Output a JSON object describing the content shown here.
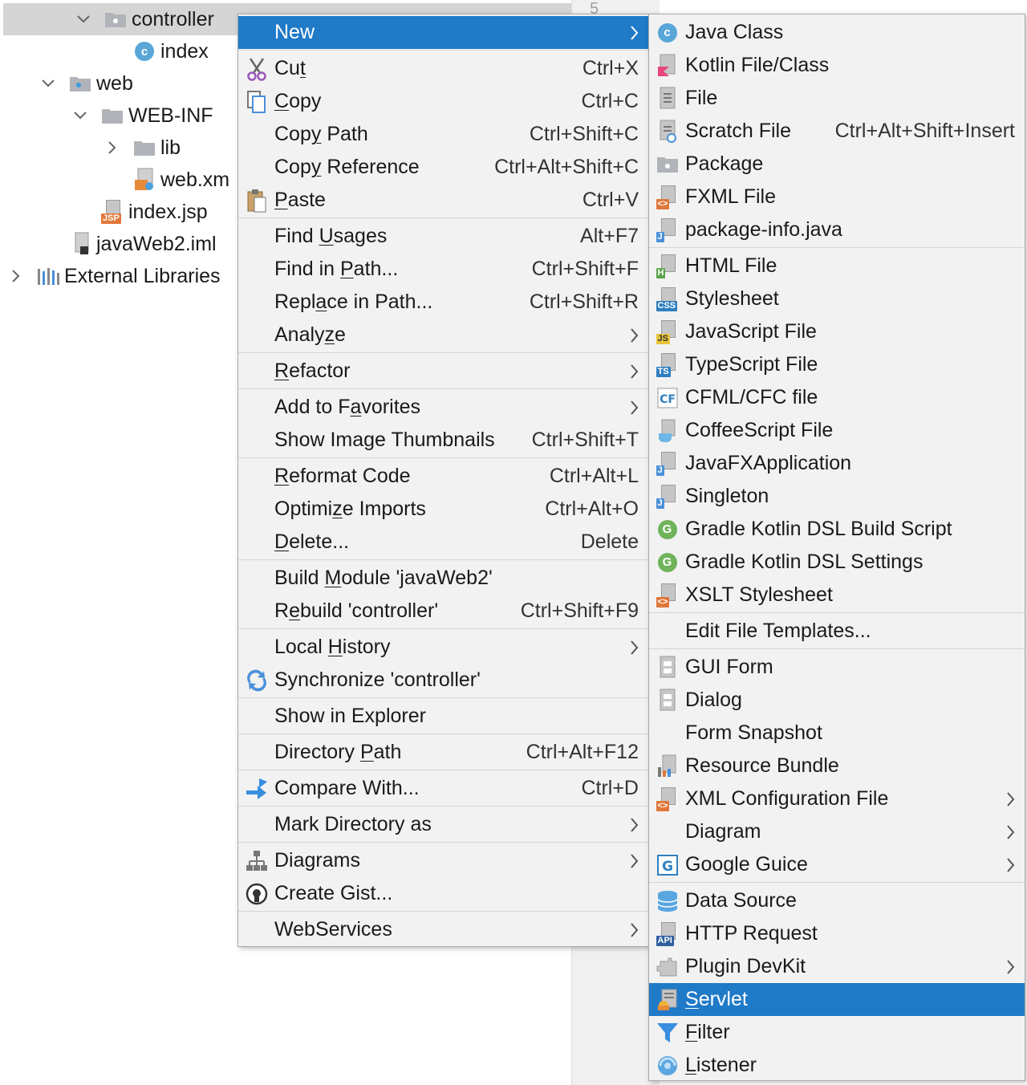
{
  "tree": {
    "items": [
      {
        "label": "controller",
        "icon": "package-folder-icon",
        "expanded": true
      },
      {
        "label": "index",
        "icon": "java-class-icon"
      },
      {
        "label": "web",
        "icon": "web-folder-icon",
        "expanded": true
      },
      {
        "label": "WEB-INF",
        "icon": "folder-icon",
        "expanded": true
      },
      {
        "label": "lib",
        "icon": "folder-icon",
        "expanded": false
      },
      {
        "label": "web.xm",
        "icon": "xml-file-icon"
      },
      {
        "label": "index.jsp",
        "icon": "jsp-file-icon"
      },
      {
        "label": "javaWeb2.iml",
        "icon": "iml-file-icon"
      },
      {
        "label": "External Libraries",
        "icon": "libraries-icon",
        "expanded": false
      }
    ],
    "line_number": "5"
  },
  "context_menu": {
    "groups": [
      [
        {
          "pre": "",
          "u": "",
          "post": "New",
          "shortcut": "",
          "submenu": true,
          "highlighted": true,
          "icon": ""
        }
      ],
      [
        {
          "pre": "Cu",
          "u": "t",
          "post": "",
          "shortcut": "Ctrl+X",
          "icon": "scissors-icon"
        },
        {
          "pre": "",
          "u": "C",
          "post": "opy",
          "shortcut": "Ctrl+C",
          "icon": "copy-icon"
        },
        {
          "pre": "Cop",
          "u": "y",
          "post": " Path",
          "shortcut": "Ctrl+Shift+C",
          "icon": ""
        },
        {
          "pre": "Cop",
          "u": "y",
          "post": " Reference",
          "shortcut": "Ctrl+Alt+Shift+C",
          "icon": ""
        },
        {
          "pre": "",
          "u": "P",
          "post": "aste",
          "shortcut": "Ctrl+V",
          "icon": "paste-icon"
        }
      ],
      [
        {
          "pre": "Find ",
          "u": "U",
          "post": "sages",
          "shortcut": "Alt+F7",
          "icon": ""
        },
        {
          "pre": "Find in ",
          "u": "P",
          "post": "ath...",
          "shortcut": "Ctrl+Shift+F",
          "icon": ""
        },
        {
          "pre": "Repl",
          "u": "a",
          "post": "ce in Path...",
          "shortcut": "Ctrl+Shift+R",
          "icon": ""
        },
        {
          "pre": "Analy",
          "u": "z",
          "post": "e",
          "shortcut": "",
          "submenu": true,
          "icon": ""
        }
      ],
      [
        {
          "pre": "",
          "u": "R",
          "post": "efactor",
          "shortcut": "",
          "submenu": true,
          "icon": ""
        }
      ],
      [
        {
          "pre": "Add to F",
          "u": "a",
          "post": "vorites",
          "shortcut": "",
          "submenu": true,
          "icon": ""
        },
        {
          "pre": "Show Image Thumbnails",
          "u": "",
          "post": "",
          "shortcut": "Ctrl+Shift+T",
          "icon": ""
        }
      ],
      [
        {
          "pre": "",
          "u": "R",
          "post": "eformat Code",
          "shortcut": "Ctrl+Alt+L",
          "icon": ""
        },
        {
          "pre": "Optimi",
          "u": "z",
          "post": "e Imports",
          "shortcut": "Ctrl+Alt+O",
          "icon": ""
        },
        {
          "pre": "",
          "u": "D",
          "post": "elete...",
          "shortcut": "Delete",
          "icon": ""
        }
      ],
      [
        {
          "pre": "Build ",
          "u": "M",
          "post": "odule 'javaWeb2'",
          "shortcut": "",
          "icon": ""
        },
        {
          "pre": "R",
          "u": "e",
          "post": "build 'controller'",
          "shortcut": "Ctrl+Shift+F9",
          "icon": ""
        }
      ],
      [
        {
          "pre": "Local ",
          "u": "H",
          "post": "istory",
          "shortcut": "",
          "submenu": true,
          "icon": ""
        },
        {
          "pre": "Synchronize 'controller'",
          "u": "",
          "post": "",
          "shortcut": "",
          "icon": "sync-icon"
        }
      ],
      [
        {
          "pre": "Show in Explorer",
          "u": "",
          "post": "",
          "shortcut": "",
          "icon": ""
        }
      ],
      [
        {
          "pre": "Directory ",
          "u": "P",
          "post": "ath",
          "shortcut": "Ctrl+Alt+F12",
          "icon": ""
        }
      ],
      [
        {
          "pre": "Compare With...",
          "u": "",
          "post": "",
          "shortcut": "Ctrl+D",
          "icon": "compare-icon"
        }
      ],
      [
        {
          "pre": "Mark Directory as",
          "u": "",
          "post": "",
          "shortcut": "",
          "submenu": true,
          "icon": ""
        }
      ],
      [
        {
          "pre": "Diagrams",
          "u": "",
          "post": "",
          "shortcut": "",
          "submenu": true,
          "icon": "diagrams-icon"
        },
        {
          "pre": "Create Gist...",
          "u": "",
          "post": "",
          "shortcut": "",
          "icon": "github-icon"
        }
      ],
      [
        {
          "pre": "WebServices",
          "u": "",
          "post": "",
          "shortcut": "",
          "submenu": true,
          "icon": ""
        }
      ]
    ]
  },
  "new_submenu": {
    "groups": [
      [
        {
          "pre": "Java Class",
          "u": "",
          "post": "",
          "shortcut": "",
          "icon": "java-class-icon"
        },
        {
          "pre": "Kotlin File/Class",
          "u": "",
          "post": "",
          "shortcut": "",
          "icon": "kotlin-file-icon"
        },
        {
          "pre": "File",
          "u": "",
          "post": "",
          "shortcut": "",
          "icon": "file-icon"
        },
        {
          "pre": "Scratch File",
          "u": "",
          "post": "",
          "shortcut": "Ctrl+Alt+Shift+Insert",
          "icon": "scratch-file-icon"
        },
        {
          "pre": "Package",
          "u": "",
          "post": "",
          "shortcut": "",
          "icon": "package-icon"
        },
        {
          "pre": "FXML File",
          "u": "",
          "post": "",
          "shortcut": "",
          "icon": "fxml-file-icon"
        },
        {
          "pre": "package-info.java",
          "u": "",
          "post": "",
          "shortcut": "",
          "icon": "package-info-icon"
        }
      ],
      [
        {
          "pre": "HTML File",
          "u": "",
          "post": "",
          "shortcut": "",
          "icon": "html-file-icon"
        },
        {
          "pre": "Stylesheet",
          "u": "",
          "post": "",
          "shortcut": "",
          "icon": "css-file-icon"
        },
        {
          "pre": "JavaScript File",
          "u": "",
          "post": "",
          "shortcut": "",
          "icon": "js-file-icon"
        },
        {
          "pre": "TypeScript File",
          "u": "",
          "post": "",
          "shortcut": "",
          "icon": "ts-file-icon"
        },
        {
          "pre": "CFML/CFC file",
          "u": "",
          "post": "",
          "shortcut": "",
          "icon": "cfml-file-icon"
        },
        {
          "pre": "CoffeeScript File",
          "u": "",
          "post": "",
          "shortcut": "",
          "icon": "coffeescript-file-icon"
        },
        {
          "pre": "JavaFXApplication",
          "u": "",
          "post": "",
          "shortcut": "",
          "icon": "javafx-file-icon"
        },
        {
          "pre": "Singleton",
          "u": "",
          "post": "",
          "shortcut": "",
          "icon": "singleton-file-icon"
        },
        {
          "pre": "Gradle Kotlin DSL Build Script",
          "u": "",
          "post": "",
          "shortcut": "",
          "icon": "gradle-icon"
        },
        {
          "pre": "Gradle Kotlin DSL Settings",
          "u": "",
          "post": "",
          "shortcut": "",
          "icon": "gradle-icon"
        },
        {
          "pre": "XSLT Stylesheet",
          "u": "",
          "post": "",
          "shortcut": "",
          "icon": "xslt-file-icon"
        }
      ],
      [
        {
          "pre": "Edit File Templates...",
          "u": "",
          "post": "",
          "shortcut": "",
          "icon": ""
        }
      ],
      [
        {
          "pre": "GUI Form",
          "u": "",
          "post": "",
          "shortcut": "",
          "icon": "gui-form-icon"
        },
        {
          "pre": "Dialog",
          "u": "",
          "post": "",
          "shortcut": "",
          "icon": "dialog-icon"
        },
        {
          "pre": "Form Snapshot",
          "u": "",
          "post": "",
          "shortcut": "",
          "icon": ""
        },
        {
          "pre": "Resource Bundle",
          "u": "",
          "post": "",
          "shortcut": "",
          "icon": "resource-bundle-icon"
        },
        {
          "pre": "XML Configuration File",
          "u": "",
          "post": "",
          "shortcut": "",
          "submenu": true,
          "icon": "xml-config-icon"
        },
        {
          "pre": "Diagram",
          "u": "",
          "post": "",
          "shortcut": "",
          "submenu": true,
          "icon": ""
        },
        {
          "pre": "Google Guice",
          "u": "",
          "post": "",
          "shortcut": "",
          "submenu": true,
          "icon": "google-guice-icon"
        }
      ],
      [
        {
          "pre": "Data Source",
          "u": "",
          "post": "",
          "shortcut": "",
          "icon": "data-source-icon"
        },
        {
          "pre": "HTTP Request",
          "u": "",
          "post": "",
          "shortcut": "",
          "icon": "http-request-icon"
        },
        {
          "pre": "Plugin DevKit",
          "u": "",
          "post": "",
          "shortcut": "",
          "submenu": true,
          "icon": "plugin-devkit-icon"
        },
        {
          "pre": "",
          "u": "S",
          "post": "ervlet",
          "shortcut": "",
          "highlighted": true,
          "icon": "servlet-icon"
        },
        {
          "pre": "",
          "u": "F",
          "post": "ilter",
          "shortcut": "",
          "icon": "filter-icon"
        },
        {
          "pre": "",
          "u": "L",
          "post": "istener",
          "shortcut": "",
          "icon": "listener-icon"
        }
      ]
    ]
  },
  "colors": {
    "highlight": "#1f7ac8",
    "menu_bg": "#f2f2f2",
    "selection_row": "#d5d5d5"
  }
}
